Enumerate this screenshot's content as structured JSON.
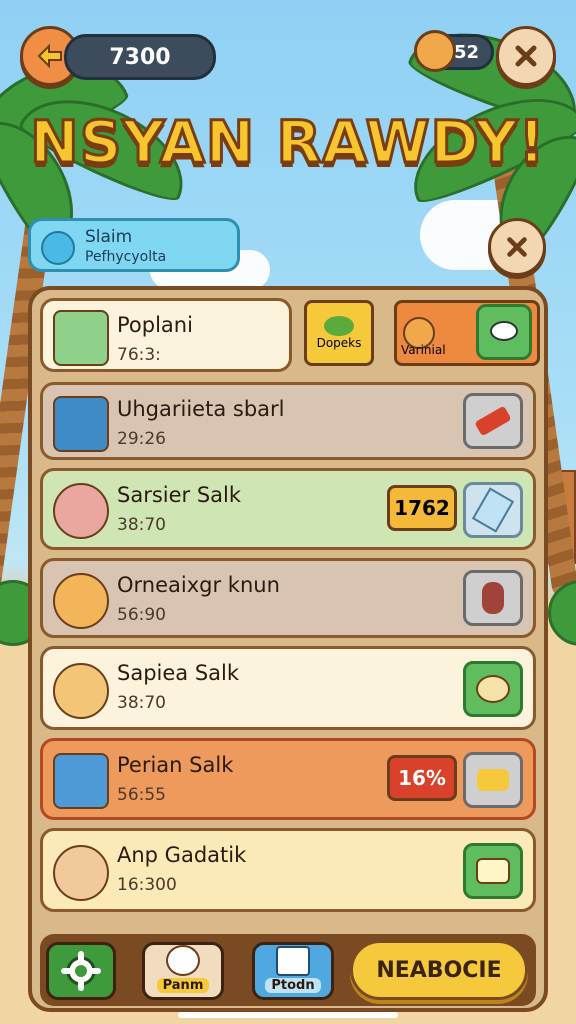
{
  "header": {
    "coins": "7300",
    "pets_count": "52",
    "title": "NSYAN RAWDY!"
  },
  "status": {
    "line1": "Slaim",
    "line2": "Pefhycyolta"
  },
  "featured_row": {
    "name": "Poplani",
    "time": "76:3:",
    "tag1": "Dopeks",
    "tag2": "Varinial"
  },
  "rows": [
    {
      "name": "Uhgariieta sbarl",
      "time": "29:26"
    },
    {
      "name": "Sarsier Salk",
      "time": "38:70",
      "badge": "1762"
    },
    {
      "name": "Orneaixgr knun",
      "time": "56:90"
    },
    {
      "name": "Sapiea Salk",
      "time": "38:70"
    },
    {
      "name": "Perian Salk",
      "time": "56:55",
      "badge": "16%"
    },
    {
      "name": "Anp Gadatik",
      "time": "16:300"
    }
  ],
  "bottom_bar": {
    "tab_pet": "Panm",
    "tab_photo": "Ptodn",
    "primary": "NEABOCIE"
  },
  "colors": {
    "title_fill": "#f7c62f",
    "panel": "#d9b88a",
    "accent_orange": "#f08e45",
    "badge_red": "#d9412b",
    "badge_gold": "#f5b93a"
  }
}
